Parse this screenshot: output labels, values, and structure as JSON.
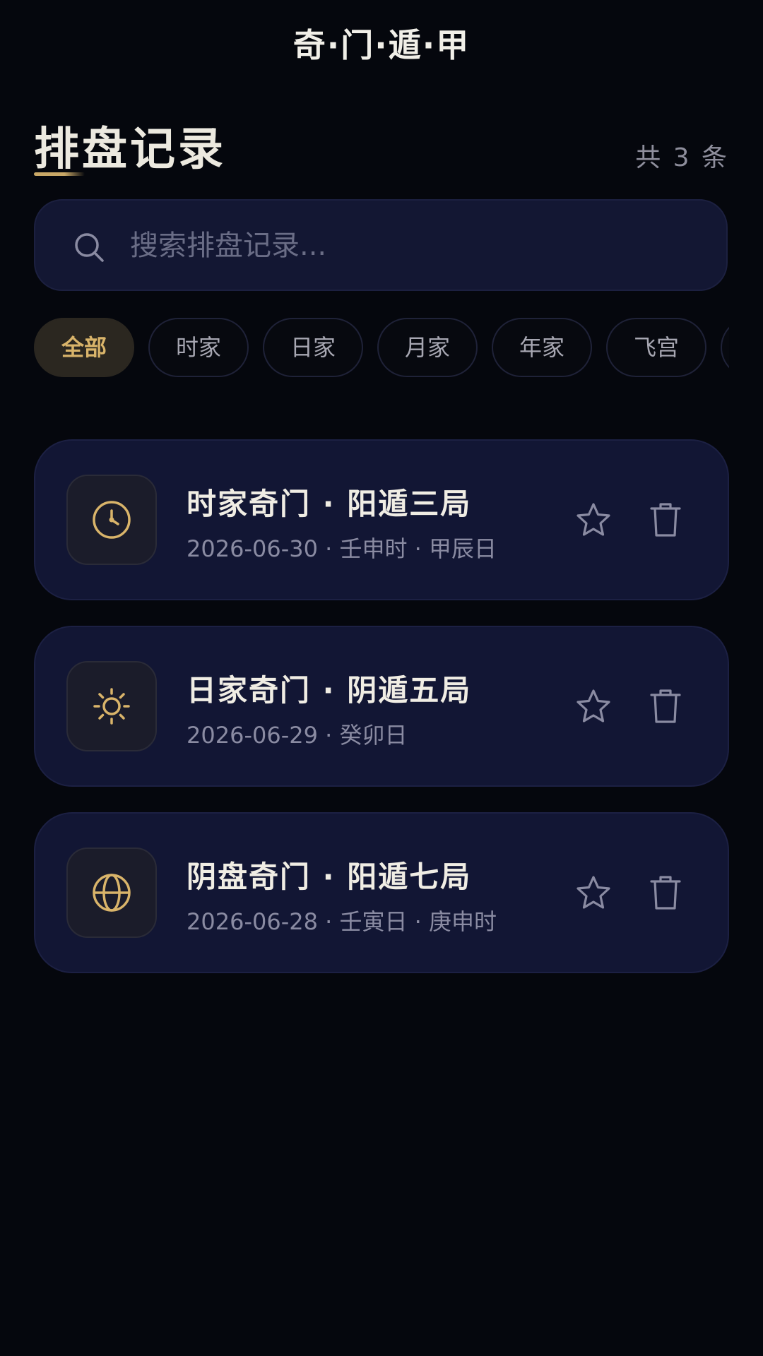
{
  "app": {
    "title": "奇·门·遁·甲"
  },
  "header": {
    "title": "排盘记录",
    "count_label": "共 3 条"
  },
  "search": {
    "placeholder": "搜索排盘记录..."
  },
  "filters": [
    {
      "label": "全部",
      "active": true
    },
    {
      "label": "时家",
      "active": false
    },
    {
      "label": "日家",
      "active": false
    },
    {
      "label": "月家",
      "active": false
    },
    {
      "label": "年家",
      "active": false
    },
    {
      "label": "飞宫",
      "active": false
    }
  ],
  "records": [
    {
      "icon": "clock-icon",
      "title": "时家奇门 · 阳遁三局",
      "subtitle": "2026-06-30 · 壬申时 · 甲辰日"
    },
    {
      "icon": "sun-icon",
      "title": "日家奇门 · 阴遁五局",
      "subtitle": "2026-06-29 · 癸卯日"
    },
    {
      "icon": "globe-icon",
      "title": "阴盘奇门 · 阳遁七局",
      "subtitle": "2026-06-28 · 壬寅日 · 庚申时"
    }
  ],
  "colors": {
    "background": "#05070d",
    "card": "#121634",
    "accent_gold": "#d9b46a",
    "muted_text": "#8a8ba2"
  }
}
